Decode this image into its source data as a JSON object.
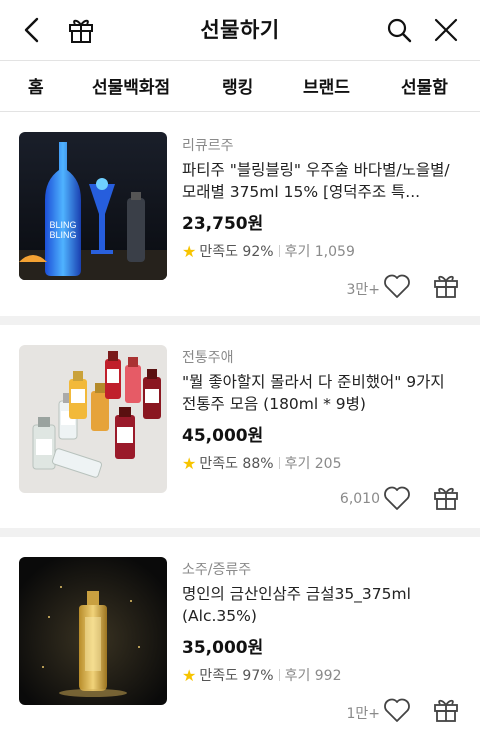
{
  "header": {
    "title": "선물하기"
  },
  "tabs": [
    {
      "label": "홈"
    },
    {
      "label": "선물백화점"
    },
    {
      "label": "랭킹"
    },
    {
      "label": "브랜드"
    },
    {
      "label": "선물함"
    }
  ],
  "products": [
    {
      "category": "리큐르주",
      "name": "파티주 \"블링블링\" 우주술 바다별/노을별/모래별 375ml 15% [영덕주조 특...",
      "price": "23,750원",
      "satisfaction": "만족도 92%",
      "reviews": "후기 1,059",
      "likes": "3만+",
      "thumb_text": "BLING BLING"
    },
    {
      "category": "전통주애",
      "name": "\"뭘 좋아할지 몰라서 다 준비했어\" 9가지 전통주 모음 (180ml * 9병)",
      "price": "45,000원",
      "satisfaction": "만족도 88%",
      "reviews": "후기 205",
      "likes": "6,010"
    },
    {
      "category": "소주/증류주",
      "name": "명인의 금산인삼주 금설35_375ml (Alc.35%)",
      "price": "35,000원",
      "satisfaction": "만족도 97%",
      "reviews": "후기 992",
      "likes": "1만+"
    }
  ],
  "colors": {
    "star": "#f7c400",
    "separator": "#f1f1f1",
    "muted": "#8a8a8a"
  },
  "icons": [
    "back-icon",
    "gift-icon",
    "search-icon",
    "close-icon",
    "star-icon",
    "heart-icon"
  ]
}
